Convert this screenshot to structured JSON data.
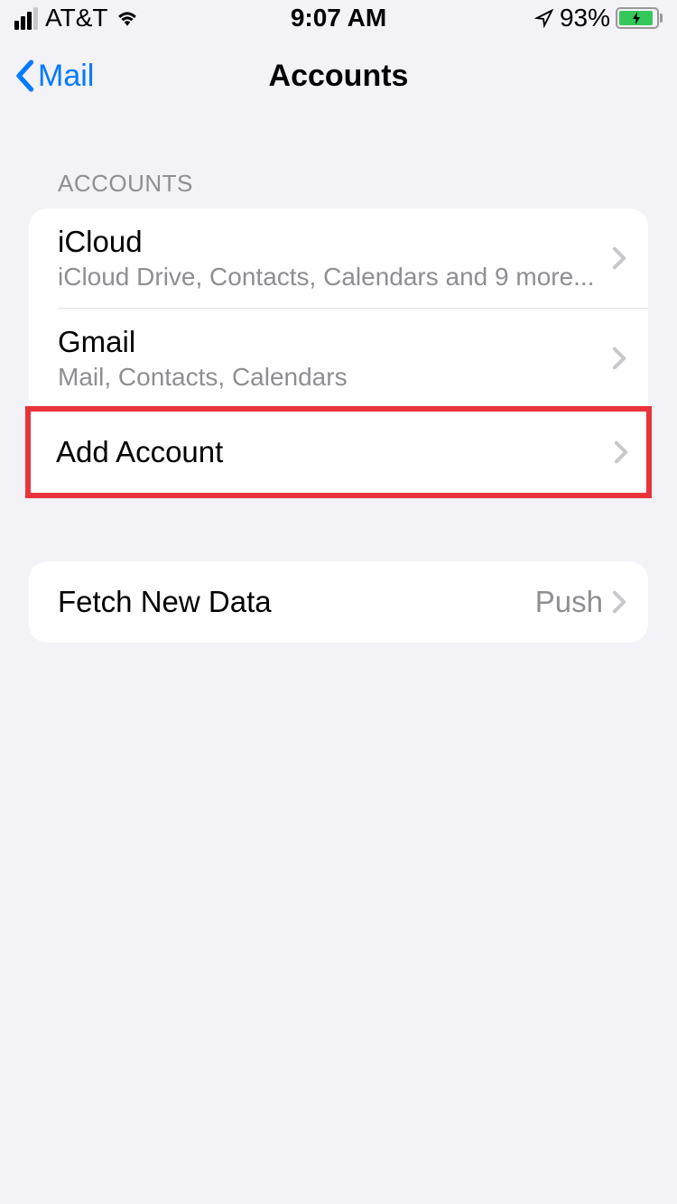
{
  "status_bar": {
    "carrier": "AT&T",
    "time": "9:07 AM",
    "battery_percent": "93%"
  },
  "nav": {
    "back_label": "Mail",
    "title": "Accounts"
  },
  "sections": {
    "accounts": {
      "header": "Accounts",
      "items": [
        {
          "title": "iCloud",
          "subtitle": "iCloud Drive, Contacts, Calendars and 9 more..."
        },
        {
          "title": "Gmail",
          "subtitle": "Mail, Contacts, Calendars"
        }
      ],
      "add_label": "Add Account"
    },
    "fetch": {
      "title": "Fetch New Data",
      "value": "Push"
    }
  }
}
